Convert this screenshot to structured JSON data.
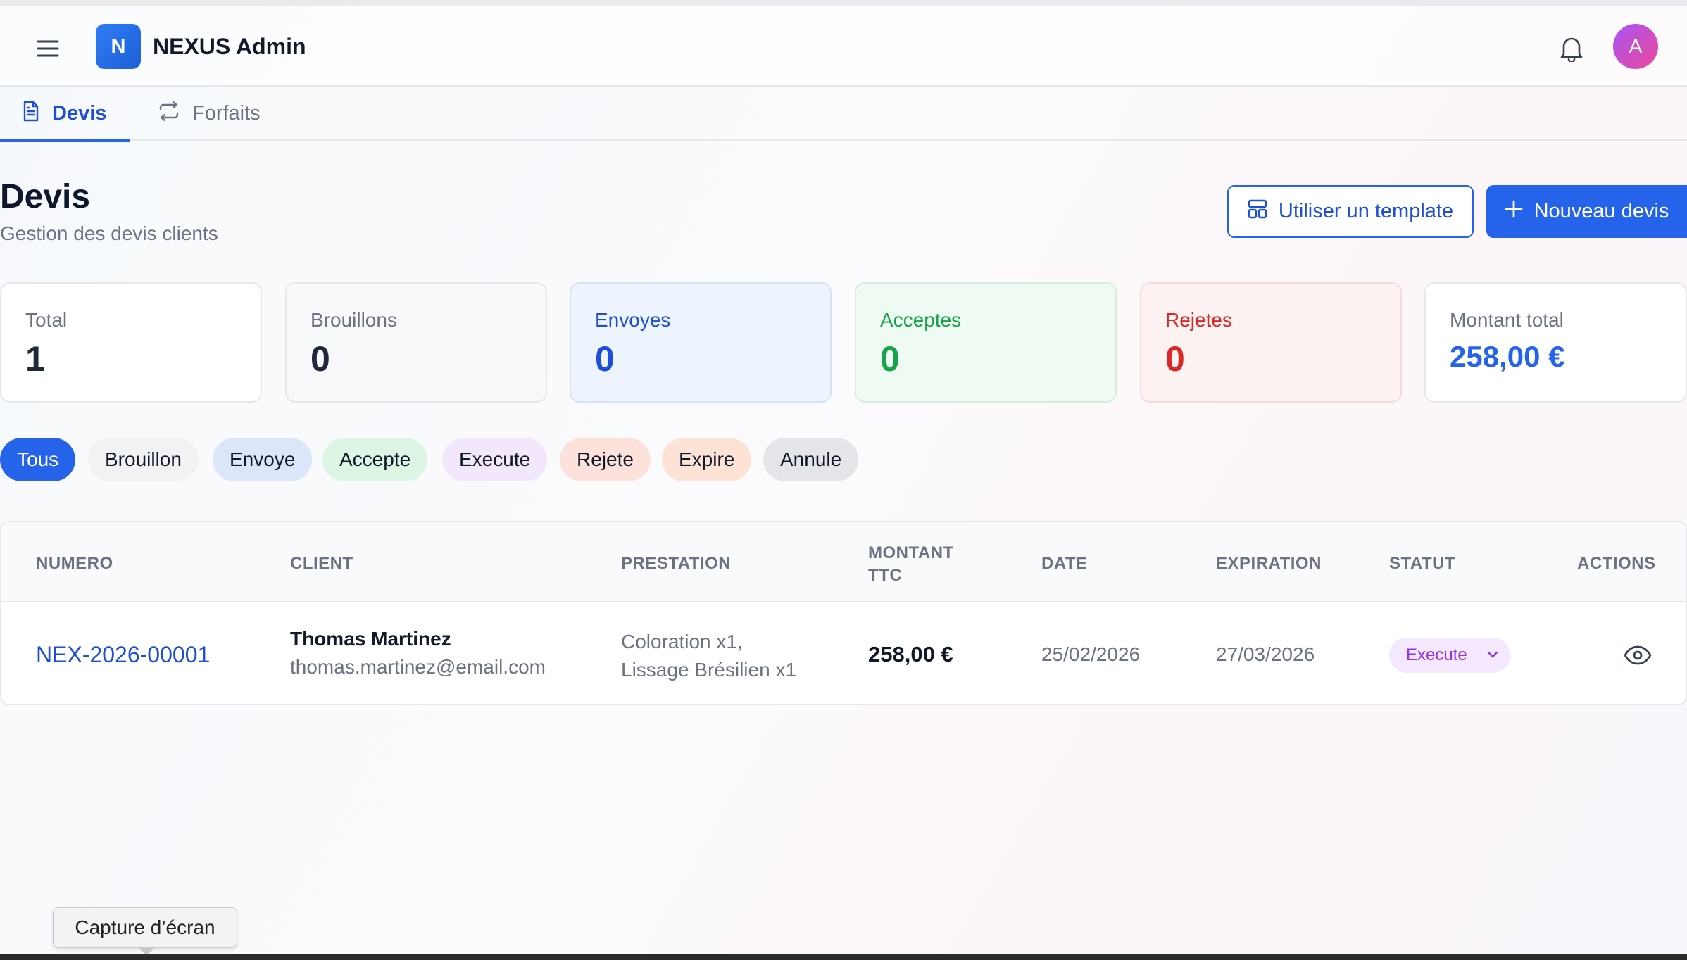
{
  "app": {
    "logo_letter": "N",
    "title": "NEXUS Admin",
    "avatar_letter": "A"
  },
  "tabs": [
    {
      "label": "Devis",
      "active": true
    },
    {
      "label": "Forfaits",
      "active": false
    }
  ],
  "page": {
    "title": "Devis",
    "subtitle": "Gestion des devis clients",
    "template_button": "Utiliser un template",
    "new_button": "Nouveau devis"
  },
  "stats": {
    "total": {
      "label": "Total",
      "value": "1"
    },
    "drafts": {
      "label": "Brouillons",
      "value": "0"
    },
    "sent": {
      "label": "Envoyes",
      "value": "0"
    },
    "accepted": {
      "label": "Acceptes",
      "value": "0"
    },
    "rejected": {
      "label": "Rejetes",
      "value": "0"
    },
    "amount": {
      "label": "Montant total",
      "value": "258,00 €"
    }
  },
  "filters": [
    "Tous",
    "Brouillon",
    "Envoye",
    "Accepte",
    "Execute",
    "Rejete",
    "Expire",
    "Annule"
  ],
  "table": {
    "headers": {
      "numero": "NUMERO",
      "client": "CLIENT",
      "prestation": "PRESTATION",
      "montant_line1": "MONTANT",
      "montant_line2": "TTC",
      "date": "DATE",
      "expiration": "EXPIRATION",
      "statut": "STATUT",
      "actions": "ACTIONS"
    },
    "rows": [
      {
        "numero": "NEX-2026-00001",
        "client_name": "Thomas Martinez",
        "client_email": "thomas.martinez@email.com",
        "prestation_line1": "Coloration x1,",
        "prestation_line2": "Lissage Brésilien x1",
        "montant": "258,00 €",
        "date": "25/02/2026",
        "expiration": "27/03/2026",
        "statut": "Execute"
      }
    ]
  },
  "tooltip": "Capture d’écran",
  "colors": {
    "primary": "#2563eb",
    "success": "#16a34a",
    "danger": "#dc2626",
    "purple": "#9333ea"
  }
}
